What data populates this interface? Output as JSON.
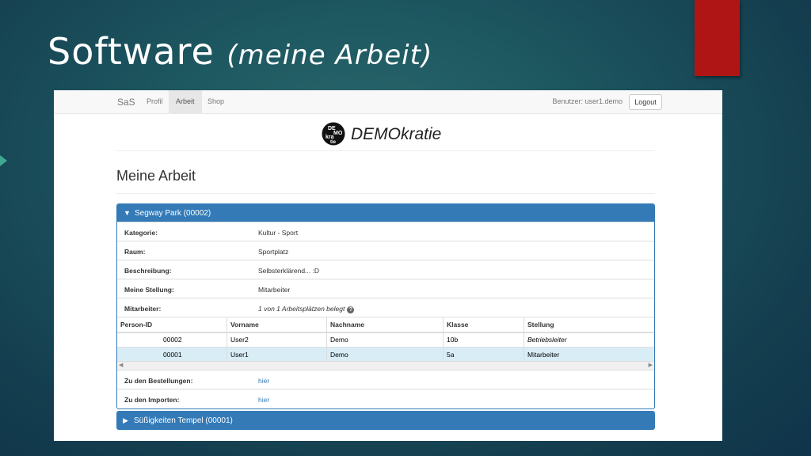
{
  "slide": {
    "title": "Software",
    "subtitle": "(meine Arbeit)"
  },
  "navbar": {
    "brand": "SaS",
    "items": [
      {
        "label": "Profil",
        "active": false
      },
      {
        "label": "Arbeit",
        "active": true
      },
      {
        "label": "Shop",
        "active": false
      }
    ],
    "user_text": "Benutzer: user1.demo",
    "logout_label": "Logout"
  },
  "logo": {
    "mark_text": [
      "DE",
      "MO",
      "kra",
      "tie"
    ],
    "text": "DEMOkratie"
  },
  "page": {
    "title": "Meine Arbeit"
  },
  "panel": {
    "heading": "Segway Park (00002)",
    "rows": [
      {
        "key": "Kategorie:",
        "value": "Kultur - Sport"
      },
      {
        "key": "Raum:",
        "value": "Sportplatz"
      },
      {
        "key": "Beschreibung:",
        "value": "Selbsterklärend... :D"
      },
      {
        "key": "Meine Stellung:",
        "value": "Mitarbeiter"
      },
      {
        "key": "Mitarbeiter:",
        "value": "1 von 1 Arbeitsplätzen belegt"
      }
    ],
    "table": {
      "headers": [
        "Person-ID",
        "Vorname",
        "Nachname",
        "Klasse",
        "Stellung"
      ],
      "rows": [
        [
          "00002",
          "User2",
          "Demo",
          "10b",
          "Betriebsleiter"
        ],
        [
          "00001",
          "User1",
          "Demo",
          "5a",
          "Mitarbeiter"
        ]
      ]
    },
    "links": [
      {
        "key": "Zu den Bestellungen:",
        "value": "hier"
      },
      {
        "key": "Zu den Importen:",
        "value": "hier"
      }
    ]
  },
  "panel2": {
    "heading": "Süßigkeiten Tempel (00001)"
  },
  "colors": {
    "accent_red": "#b01515",
    "panel_blue": "#337ab7",
    "row_highlight": "#d9edf7"
  }
}
